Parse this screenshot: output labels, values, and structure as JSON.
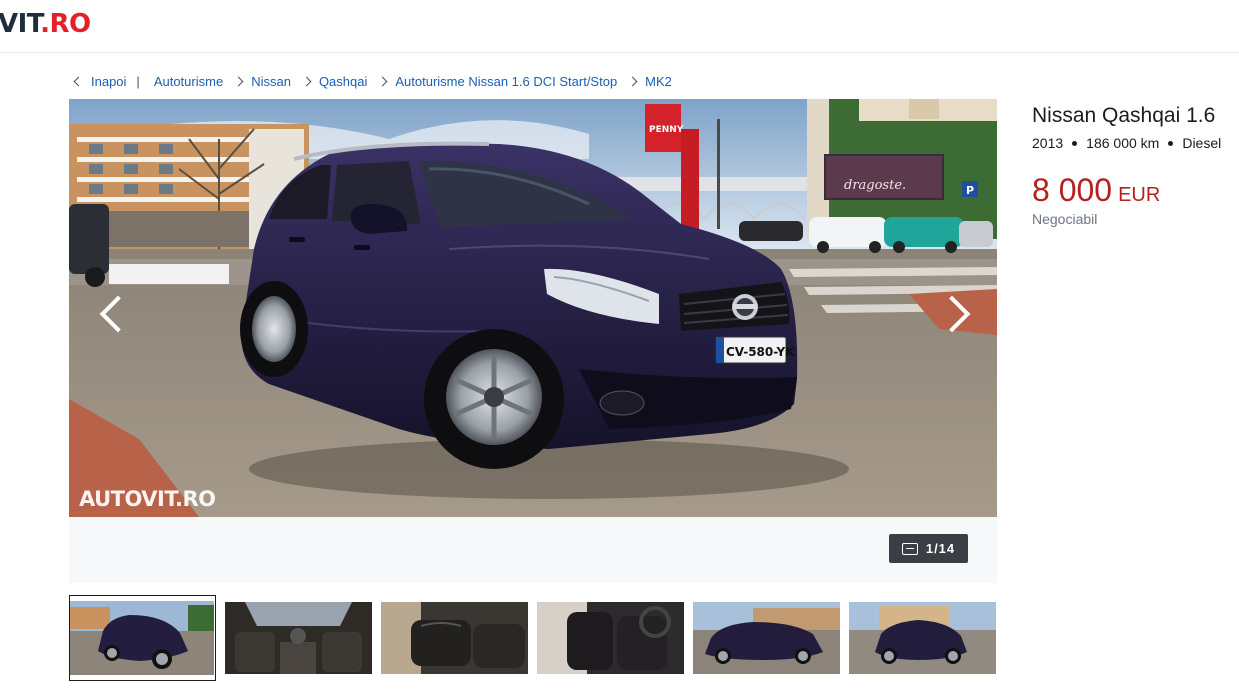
{
  "header": {
    "logo_part1": "VIT",
    "logo_part2": ".RO"
  },
  "breadcrumb": {
    "back_label": "Inapoi",
    "separator": "|",
    "items": [
      "Autoturisme",
      "Nissan",
      "Qashqai",
      "Autoturisme Nissan 1.6 DCI Start/Stop",
      "MK2"
    ]
  },
  "gallery": {
    "watermark": "AUTOVIT.RO",
    "counter": "1/14",
    "plate": "CV-580-YK",
    "billboard_text": "dragoste.",
    "store_sign": "PENNY",
    "parking_sign": "P"
  },
  "listing": {
    "title": "Nissan Qashqai 1.6",
    "year": "2013",
    "mileage": "186 000 km",
    "fuel": "Diesel",
    "price": "8 000",
    "currency": "EUR",
    "negotiable": "Negociabil"
  },
  "thumbnail_count": 6,
  "colors": {
    "link": "#1a5fb4",
    "price": "#b72020",
    "car": "#1e1a3a"
  }
}
